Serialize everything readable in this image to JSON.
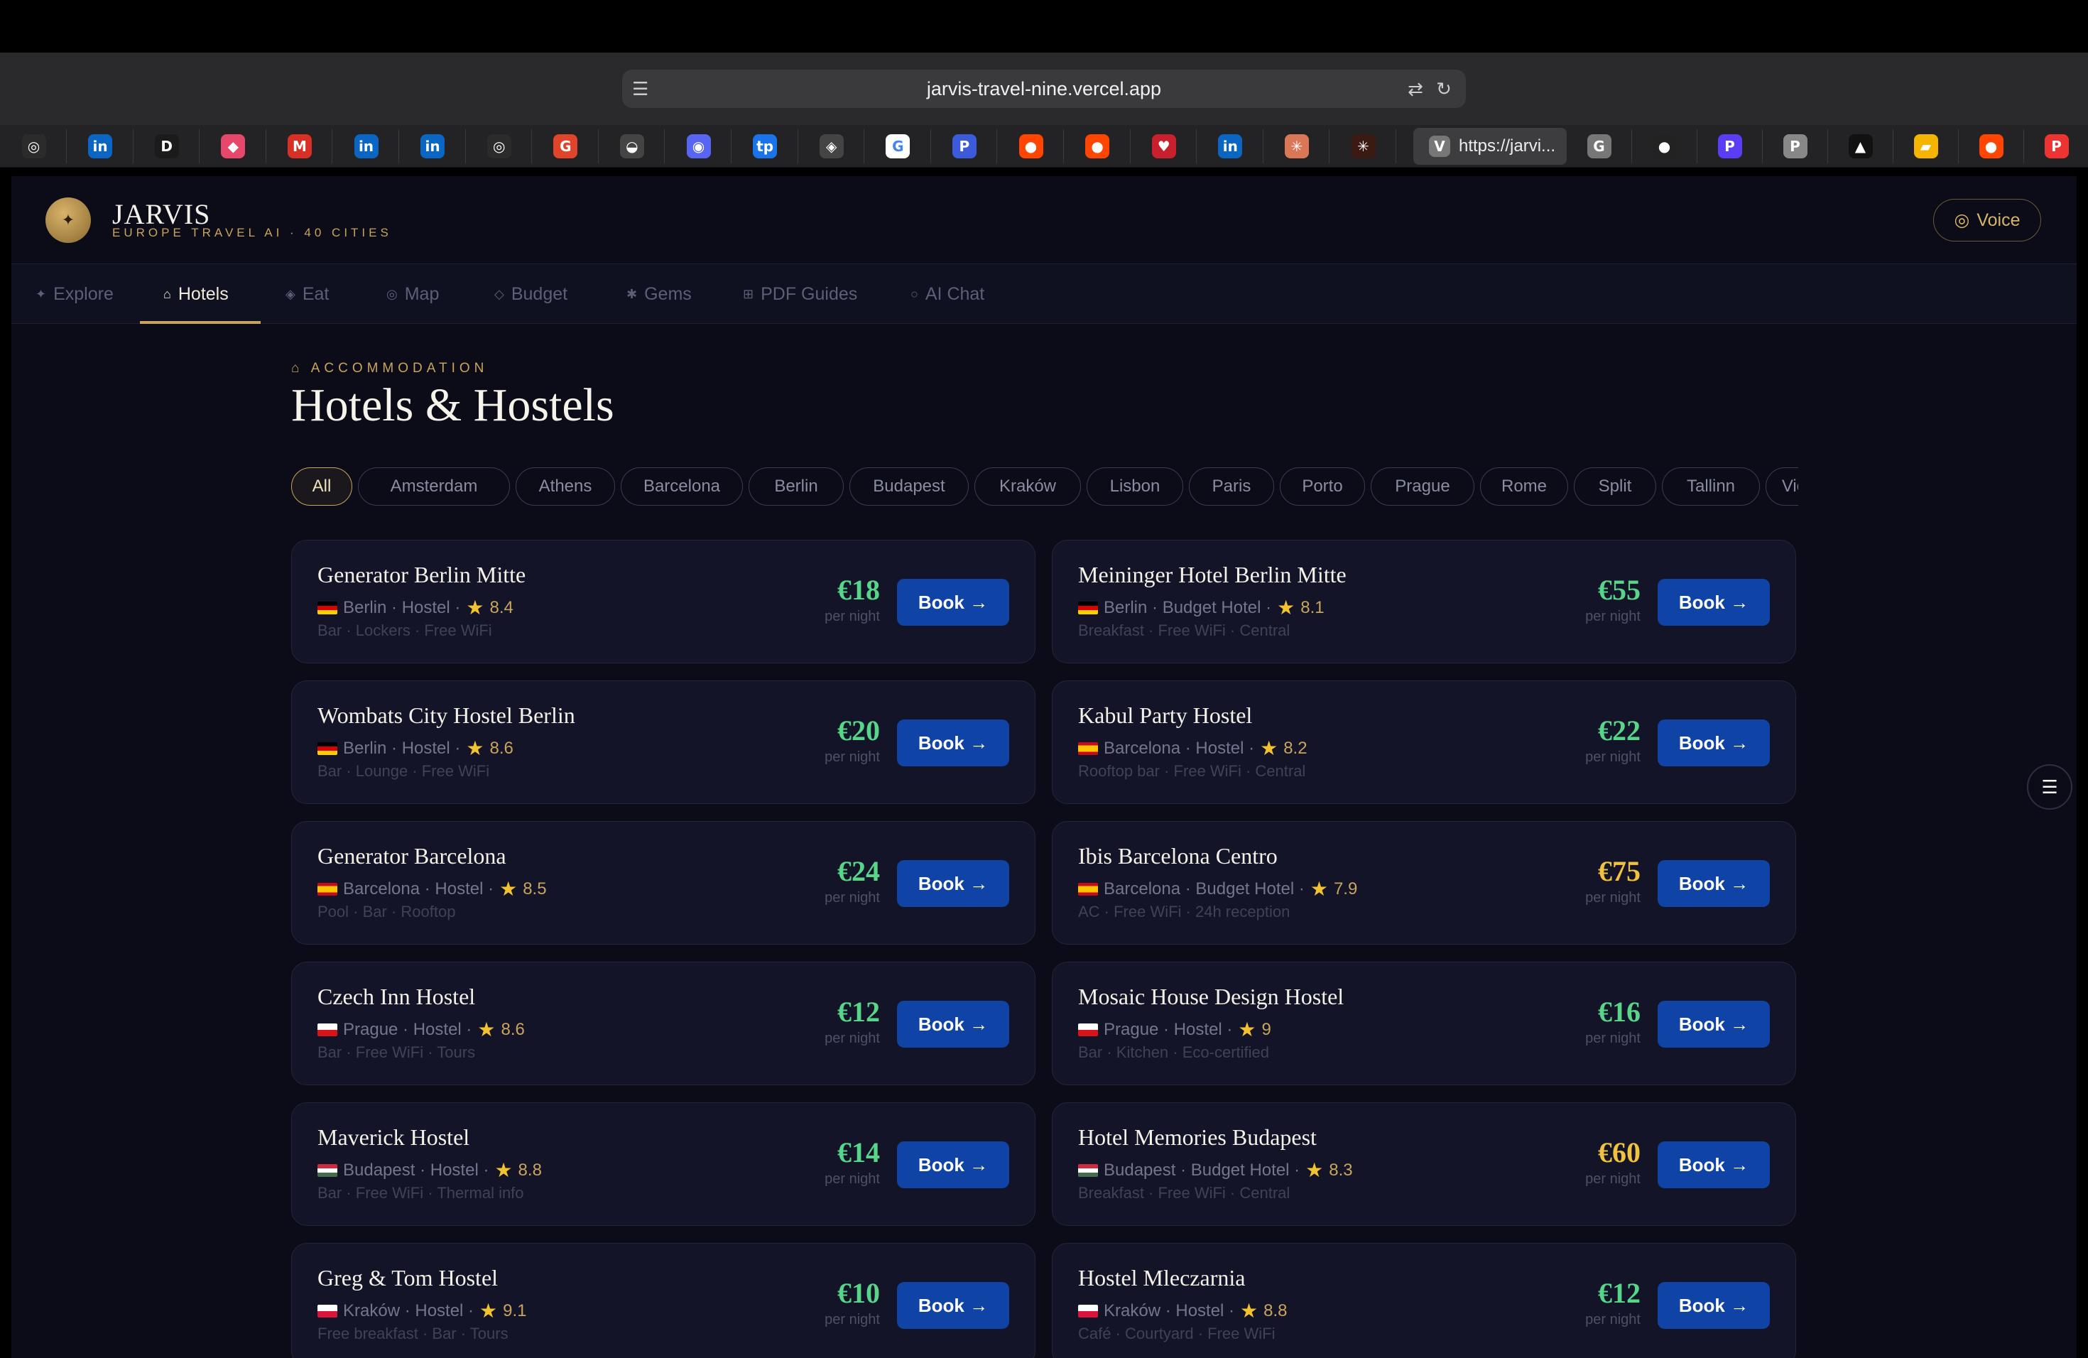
{
  "browser": {
    "url": "jarvis-travel-nine.vercel.app",
    "active_tab_label": "https://jarvi..."
  },
  "bookmarks": [
    {
      "icon": "openai-icon",
      "glyph": "◎",
      "color": "#2b2b2b"
    },
    {
      "icon": "linkedin-icon",
      "glyph": "in",
      "color": "#0a66c2"
    },
    {
      "icon": "dl-icon",
      "glyph": "D",
      "color": "#1b1b1b"
    },
    {
      "icon": "ticket-icon",
      "glyph": "◆",
      "color": "#e5486b"
    },
    {
      "icon": "gmail-icon",
      "glyph": "M",
      "color": "#d93025"
    },
    {
      "icon": "linkedin-icon",
      "glyph": "in",
      "color": "#0a66c2"
    },
    {
      "icon": "linkedin-icon",
      "glyph": "in",
      "color": "#0a66c2"
    },
    {
      "icon": "openai-icon",
      "glyph": "◎",
      "color": "#2b2b2b"
    },
    {
      "icon": "g-red-icon",
      "glyph": "G",
      "color": "#e0452b"
    },
    {
      "icon": "whale-icon",
      "glyph": "◒",
      "color": "#444"
    },
    {
      "icon": "discord-icon",
      "glyph": "◉",
      "color": "#5865f2"
    },
    {
      "icon": "tp-icon",
      "glyph": "tp",
      "color": "#1a73e8"
    },
    {
      "icon": "cube-icon",
      "glyph": "◈",
      "color": "#444"
    },
    {
      "icon": "google-icon",
      "glyph": "G",
      "color": "#ffffff"
    },
    {
      "icon": "p-blue-icon",
      "glyph": "P",
      "color": "#3b5bdb"
    },
    {
      "icon": "reddit-icon",
      "glyph": "●",
      "color": "#ff4500"
    },
    {
      "icon": "reddit-icon",
      "glyph": "●",
      "color": "#ff4500"
    },
    {
      "icon": "heart-icon",
      "glyph": "♥",
      "color": "#c9202e"
    },
    {
      "icon": "linkedin-icon",
      "glyph": "in",
      "color": "#0a66c2"
    },
    {
      "icon": "claude-icon",
      "glyph": "✳",
      "color": "#d97757"
    },
    {
      "icon": "claude-icon",
      "glyph": "✳",
      "color": "#3a1a12"
    }
  ],
  "bookmarks_right": [
    {
      "icon": "g-gray-icon",
      "glyph": "G",
      "color": "#777"
    },
    {
      "icon": "github-icon",
      "glyph": "●",
      "color": "#222"
    },
    {
      "icon": "p-purple-icon",
      "glyph": "P",
      "color": "#5b3df5"
    },
    {
      "icon": "p-gray-icon",
      "glyph": "P",
      "color": "#888"
    },
    {
      "icon": "a-icon",
      "glyph": "▲",
      "color": "#111"
    },
    {
      "icon": "drive-icon",
      "glyph": "▰",
      "color": "#f4b400"
    },
    {
      "icon": "reddit-icon",
      "glyph": "●",
      "color": "#ff4500"
    },
    {
      "icon": "p-red-icon",
      "glyph": "P",
      "color": "#e33"
    }
  ],
  "app": {
    "brand": "JARVIS",
    "tagline": "EUROPE TRAVEL AI · 40 CITIES",
    "voice_label": "Voice"
  },
  "nav": [
    {
      "icon": "✦",
      "label": "Explore",
      "active": false
    },
    {
      "icon": "⌂",
      "label": "Hotels",
      "active": true
    },
    {
      "icon": "◈",
      "label": "Eat",
      "active": false
    },
    {
      "icon": "◎",
      "label": "Map",
      "active": false
    },
    {
      "icon": "◇",
      "label": "Budget",
      "active": false
    },
    {
      "icon": "✱",
      "label": "Gems",
      "active": false
    },
    {
      "icon": "⊞",
      "label": "PDF Guides",
      "active": false
    },
    {
      "icon": "○",
      "label": "AI Chat",
      "active": false
    }
  ],
  "section": {
    "eyebrow": "⌂ ACCOMMODATION",
    "title": "Hotels & Hostels"
  },
  "city_filters": [
    "All",
    "Amsterdam",
    "Athens",
    "Barcelona",
    "Berlin",
    "Budapest",
    "Kraków",
    "Lisbon",
    "Paris",
    "Porto",
    "Prague",
    "Rome",
    "Split",
    "Tallinn",
    "Vie"
  ],
  "active_filter": "All",
  "book_label": "Book →",
  "per_night_label": "per night",
  "hotels": [
    {
      "name": "Generator Berlin Mitte",
      "flag": "de",
      "meta": "Berlin · Hostel ·",
      "rating": "8.4",
      "features": "Bar · Lockers · Free WiFi",
      "price": "€18",
      "tier": "low"
    },
    {
      "name": "Meininger Hotel Berlin Mitte",
      "flag": "de",
      "meta": "Berlin · Budget Hotel ·",
      "rating": "8.1",
      "features": "Breakfast · Free WiFi · Central",
      "price": "€55",
      "tier": "low"
    },
    {
      "name": "Wombats City Hostel Berlin",
      "flag": "de",
      "meta": "Berlin · Hostel ·",
      "rating": "8.6",
      "features": "Bar · Lounge · Free WiFi",
      "price": "€20",
      "tier": "low"
    },
    {
      "name": "Kabul Party Hostel",
      "flag": "es",
      "meta": "Barcelona · Hostel ·",
      "rating": "8.2",
      "features": "Rooftop bar · Free WiFi · Central",
      "price": "€22",
      "tier": "low"
    },
    {
      "name": "Generator Barcelona",
      "flag": "es",
      "meta": "Barcelona · Hostel ·",
      "rating": "8.5",
      "features": "Pool · Bar · Rooftop",
      "price": "€24",
      "tier": "low"
    },
    {
      "name": "Ibis Barcelona Centro",
      "flag": "es",
      "meta": "Barcelona · Budget Hotel ·",
      "rating": "7.9",
      "features": "AC · Free WiFi · 24h reception",
      "price": "€75",
      "tier": "mid"
    },
    {
      "name": "Czech Inn Hostel",
      "flag": "cz",
      "meta": "Prague · Hostel ·",
      "rating": "8.6",
      "features": "Bar · Free WiFi · Tours",
      "price": "€12",
      "tier": "low"
    },
    {
      "name": "Mosaic House Design Hostel",
      "flag": "cz",
      "meta": "Prague · Hostel ·",
      "rating": "9",
      "features": "Bar · Kitchen · Eco-certified",
      "price": "€16",
      "tier": "low"
    },
    {
      "name": "Maverick Hostel",
      "flag": "hu",
      "meta": "Budapest · Hostel ·",
      "rating": "8.8",
      "features": "Bar · Free WiFi · Thermal info",
      "price": "€14",
      "tier": "low"
    },
    {
      "name": "Hotel Memories Budapest",
      "flag": "hu",
      "meta": "Budapest · Budget Hotel ·",
      "rating": "8.3",
      "features": "Breakfast · Free WiFi · Central",
      "price": "€60",
      "tier": "mid"
    },
    {
      "name": "Greg & Tom Hostel",
      "flag": "pl",
      "meta": "Kraków · Hostel ·",
      "rating": "9.1",
      "features": "Free breakfast · Bar · Tours",
      "price": "€10",
      "tier": "low"
    },
    {
      "name": "Hostel Mleczarnia",
      "flag": "pl",
      "meta": "Kraków · Hostel ·",
      "rating": "8.8",
      "features": "Café · Courtyard · Free WiFi",
      "price": "€12",
      "tier": "low"
    }
  ]
}
